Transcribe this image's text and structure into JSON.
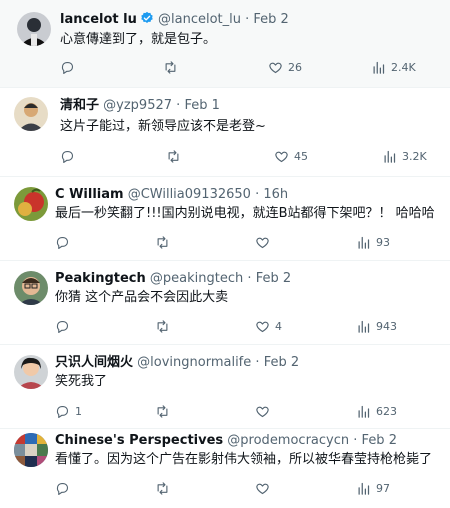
{
  "tweets": [
    {
      "name": "lancelot lu",
      "verified": true,
      "handle": "@lancelot_lu",
      "separator": "·",
      "time": "Feb 2",
      "text": "心意傳達到了，就是包子。",
      "replies": "",
      "retweets": "",
      "likes": "26",
      "views": "2.4K"
    },
    {
      "name": "清和子",
      "verified": false,
      "handle": "@yzp9527",
      "separator": "·",
      "time": "Feb 1",
      "text": "这片子能过，新领导应该不是老登~",
      "replies": "",
      "retweets": "",
      "likes": "45",
      "views": "3.2K"
    },
    {
      "name": "C William",
      "verified": false,
      "handle": "@CWillia09132650",
      "separator": "·",
      "time": "16h",
      "text": "最后一秒笑翻了!!!国内别说电视，就连B站都得下架吧？！ 哈哈哈",
      "replies": "",
      "retweets": "",
      "likes": "",
      "views": "93"
    },
    {
      "name": "Peakingtech",
      "verified": false,
      "handle": "@peakingtech",
      "separator": "·",
      "time": "Feb 2",
      "text": "你猜 这个产品会不会因此大卖",
      "replies": "",
      "retweets": "",
      "likes": "4",
      "views": "943"
    },
    {
      "name": "只识人间烟火",
      "verified": false,
      "handle": "@lovingnormalife",
      "separator": "·",
      "time": "Feb 2",
      "text": "笑死我了",
      "replies": "1",
      "retweets": "",
      "likes": "",
      "views": "623"
    },
    {
      "name": "Chinese's Perspectives",
      "verified": false,
      "handle": "@prodemocracycn",
      "separator": "·",
      "time": "Feb 2",
      "text": "看懂了。因为这个广告在影射伟大领袖，所以被华春莹持枪枪毙了",
      "replies": "",
      "retweets": "",
      "likes": "",
      "views": "97"
    }
  ],
  "icons": {
    "reply": "reply-icon",
    "retweet": "retweet-icon",
    "like": "heart-icon",
    "views": "views-icon",
    "verified": "verified-badge-icon"
  },
  "colors": {
    "text": "#0f1419",
    "secondary": "#536471",
    "verified": "#1d9bf0",
    "first_bg": "#f7f9f9"
  }
}
